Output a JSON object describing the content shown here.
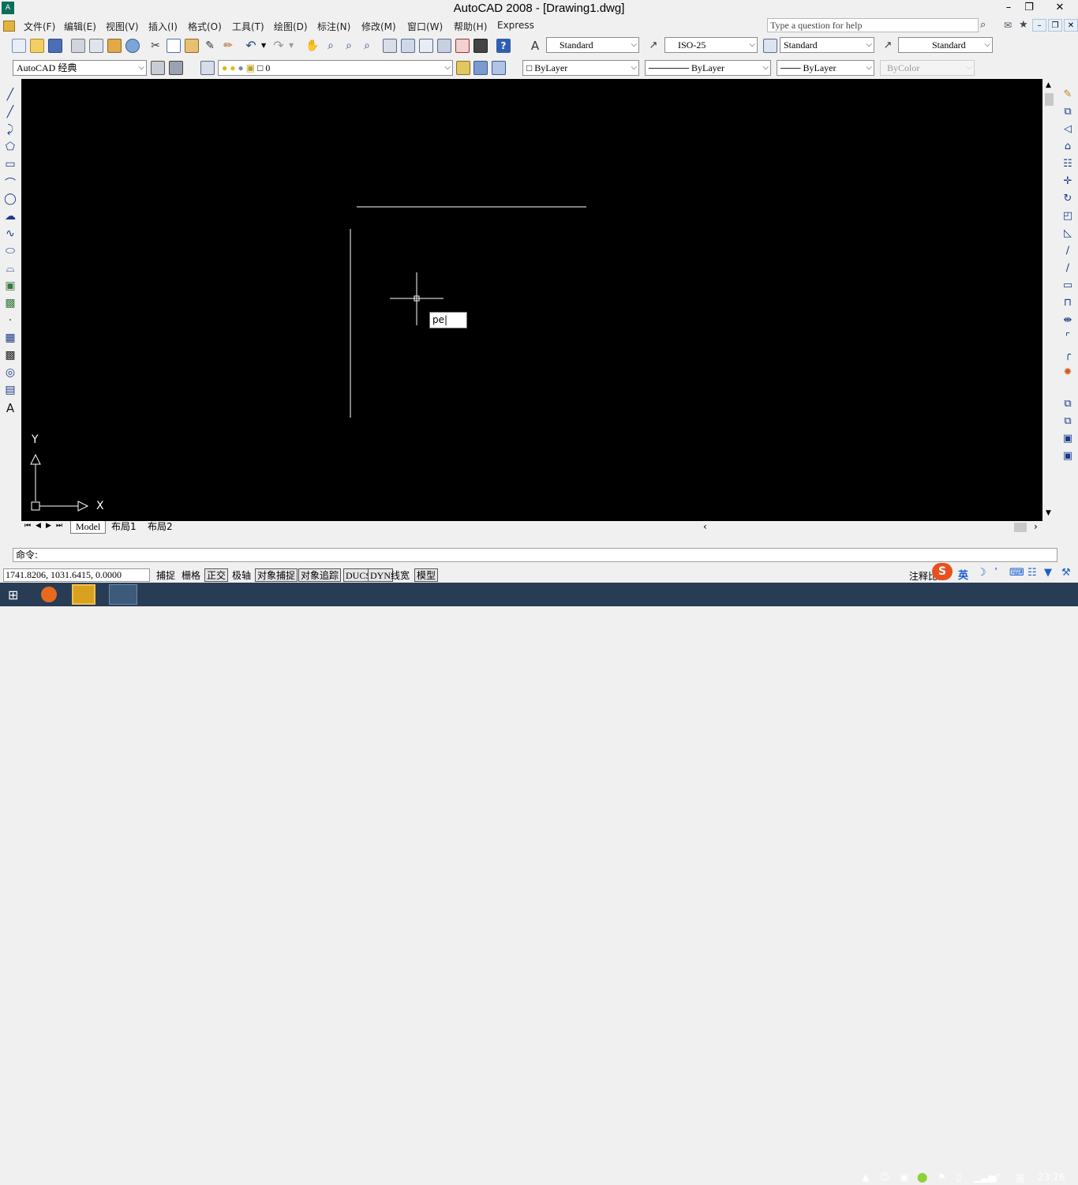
{
  "window": {
    "title": "AutoCAD 2008 - [Drawing1.dwg]"
  },
  "menus": [
    "文件(F)",
    "编辑(E)",
    "视图(V)",
    "插入(I)",
    "格式(O)",
    "工具(T)",
    "绘图(D)",
    "标注(N)",
    "修改(M)",
    "窗口(W)",
    "帮助(H)",
    "Express"
  ],
  "help": {
    "placeholder": "Type a question for help"
  },
  "styles": {
    "text_style": "Standard",
    "dim_style": "ISO-25",
    "table_style": "Standard",
    "mleader_style": "Standard"
  },
  "workspace": {
    "name": "AutoCAD 经典"
  },
  "layer": {
    "current": "0"
  },
  "properties": {
    "color": "ByLayer",
    "linetype": "ByLayer",
    "lineweight": "ByLayer",
    "plotstyle": "ByColor"
  },
  "canvas": {
    "dyn_input": "pe",
    "ucs_x": "X",
    "ucs_y": "Y"
  },
  "tabs": [
    "Model",
    "布局1",
    "布局2"
  ],
  "command": {
    "prompt": "命令:"
  },
  "status": {
    "coordinates": "1741.8206, 1031.6415, 0.0000",
    "toggles": [
      {
        "label": "捕捉",
        "on": false
      },
      {
        "label": "栅格",
        "on": false
      },
      {
        "label": "正交",
        "on": true
      },
      {
        "label": "极轴",
        "on": false
      },
      {
        "label": "对象捕捉",
        "on": true
      },
      {
        "label": "对象追踪",
        "on": true
      },
      {
        "label": "DUCS",
        "on": true
      },
      {
        "label": "DYN",
        "on": true
      },
      {
        "label": "线宽",
        "on": false
      },
      {
        "label": "模型",
        "on": true
      }
    ],
    "annotation": "注释比"
  },
  "ime": {
    "lang": "英"
  },
  "taskbar": {
    "clock": "23:26",
    "lang": "英"
  },
  "colors": {
    "canvas_bg": "#000000",
    "taskbar_bg": "#283c55",
    "ime_logo": "#e8501e"
  }
}
